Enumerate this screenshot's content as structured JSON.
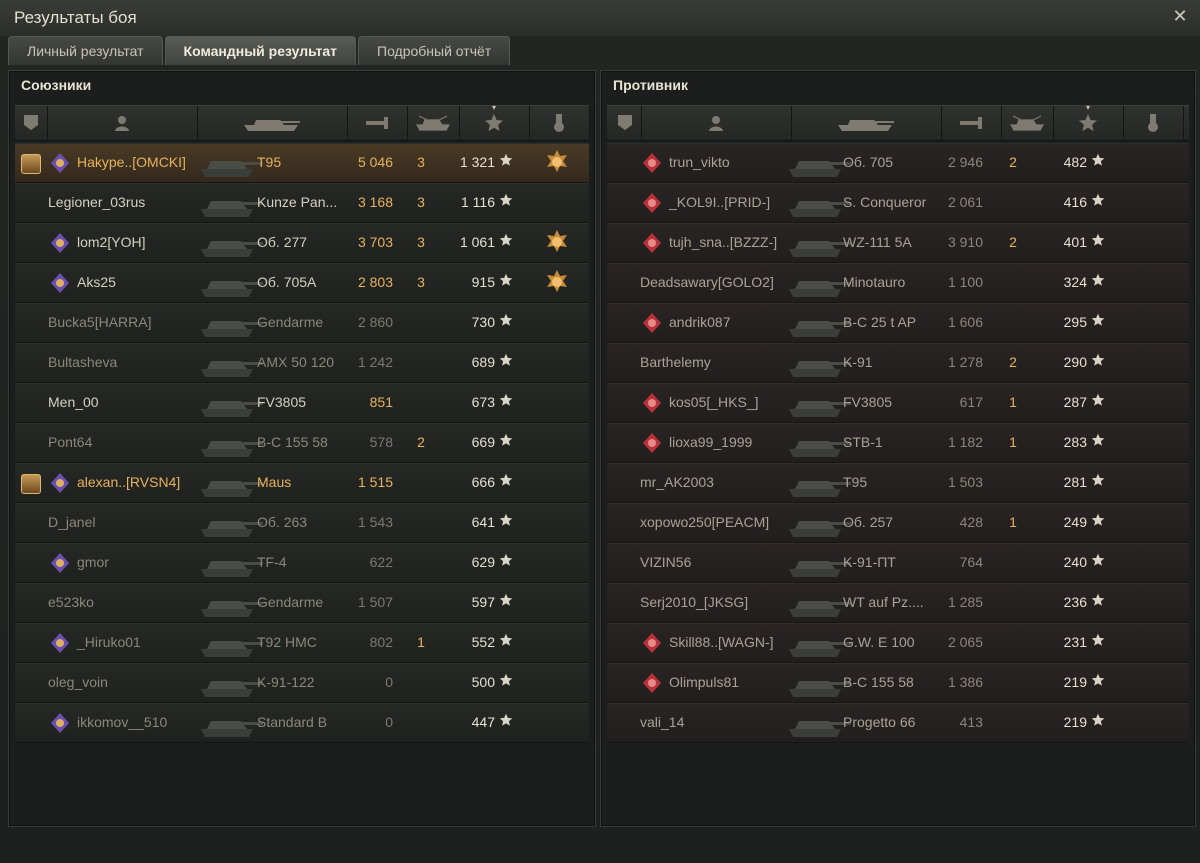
{
  "window": {
    "title": "Результаты боя"
  },
  "tabs": [
    {
      "label": "Личный результат",
      "active": false
    },
    {
      "label": "Командный результат",
      "active": true
    },
    {
      "label": "Подробный отчёт",
      "active": false
    }
  ],
  "allies": {
    "title": "Союзники",
    "rows": [
      {
        "name": "Hakype..[OMCKI]",
        "clan": true,
        "self": true,
        "vehicle": "T95",
        "damage": "5 046",
        "frags": "3",
        "xp": "1 321",
        "medal": true,
        "style": "gold"
      },
      {
        "name": "Legioner_03rus",
        "clan": false,
        "vehicle": "Kunze Pan...",
        "damage": "3 168",
        "frags": "3",
        "xp": "1 116",
        "medal": false,
        "style": "bright"
      },
      {
        "name": "lom2[YOH]",
        "clan": true,
        "vehicle": "Об. 277",
        "damage": "3 703",
        "frags": "3",
        "xp": "1 061",
        "medal": true,
        "style": "bright"
      },
      {
        "name": "Aks25",
        "clan": true,
        "vehicle": "Об. 705А",
        "damage": "2 803",
        "frags": "3",
        "xp": "915",
        "medal": true,
        "style": "bright"
      },
      {
        "name": "Bucka5[HARRA]",
        "clan": false,
        "vehicle": "Gendarme",
        "damage": "2 860",
        "frags": "",
        "xp": "730",
        "medal": false,
        "style": "dim"
      },
      {
        "name": "Bultasheva",
        "clan": false,
        "vehicle": "AMX 50 120",
        "damage": "1 242",
        "frags": "",
        "xp": "689",
        "medal": false,
        "style": "dim"
      },
      {
        "name": "Men_00",
        "clan": false,
        "vehicle": "FV3805",
        "damage": "851",
        "frags": "",
        "xp": "673",
        "medal": false,
        "style": "bright"
      },
      {
        "name": "Pont64",
        "clan": false,
        "vehicle": "B-C 155 58",
        "damage": "578",
        "frags": "2",
        "xp": "669",
        "medal": false,
        "style": "dim"
      },
      {
        "name": "alexan..[RVSN4]",
        "clan": true,
        "platoon": true,
        "vehicle": "Maus",
        "damage": "1 515",
        "frags": "",
        "xp": "666",
        "medal": false,
        "style": "gold"
      },
      {
        "name": "D_janel",
        "clan": false,
        "vehicle": "Об. 263",
        "damage": "1 543",
        "frags": "",
        "xp": "641",
        "medal": false,
        "style": "dim"
      },
      {
        "name": "gmor",
        "clan": true,
        "vehicle": "TF-4",
        "damage": "622",
        "frags": "",
        "xp": "629",
        "medal": false,
        "style": "dim"
      },
      {
        "name": "e523ko",
        "clan": false,
        "vehicle": "Gendarme",
        "damage": "1 507",
        "frags": "",
        "xp": "597",
        "medal": false,
        "style": "dim"
      },
      {
        "name": "_Hiruko01",
        "clan": true,
        "vehicle": "T92 HMC",
        "damage": "802",
        "frags": "1",
        "xp": "552",
        "medal": false,
        "style": "dim"
      },
      {
        "name": "oleg_voin",
        "clan": false,
        "vehicle": "K-91-122",
        "damage": "0",
        "frags": "",
        "xp": "500",
        "medal": false,
        "style": "dim"
      },
      {
        "name": "ikkomov__510",
        "clan": true,
        "vehicle": "Standard B",
        "damage": "0",
        "frags": "",
        "xp": "447",
        "medal": false,
        "style": "dim"
      }
    ]
  },
  "enemies": {
    "title": "Противник",
    "rows": [
      {
        "name": "trun_vikto",
        "clan": true,
        "vehicle": "Об. 705",
        "damage": "2 946",
        "frags": "2",
        "xp": "482"
      },
      {
        "name": "_KOL9I..[PRID-]",
        "clan": true,
        "vehicle": "S. Conqueror",
        "damage": "2 061",
        "frags": "",
        "xp": "416"
      },
      {
        "name": "tujh_sna..[BZZZ-]",
        "clan": true,
        "vehicle": "WZ-111 5A",
        "damage": "3 910",
        "frags": "2",
        "xp": "401"
      },
      {
        "name": "Deadsawary[GOLO2]",
        "clan": false,
        "vehicle": "Minotauro",
        "damage": "1 100",
        "frags": "",
        "xp": "324"
      },
      {
        "name": "andrik087",
        "clan": true,
        "vehicle": "B-C 25 t AP",
        "damage": "1 606",
        "frags": "",
        "xp": "295"
      },
      {
        "name": "Barthelemy",
        "clan": false,
        "vehicle": "K-91",
        "damage": "1 278",
        "frags": "2",
        "xp": "290"
      },
      {
        "name": "kos05[_HKS_]",
        "clan": true,
        "vehicle": "FV3805",
        "damage": "617",
        "frags": "1",
        "xp": "287"
      },
      {
        "name": "lioxa99_1999",
        "clan": true,
        "vehicle": "STB-1",
        "damage": "1 182",
        "frags": "1",
        "xp": "283"
      },
      {
        "name": "mr_AK2003",
        "clan": false,
        "vehicle": "T95",
        "damage": "1 503",
        "frags": "",
        "xp": "281"
      },
      {
        "name": "xopowo250[PEACM]",
        "clan": false,
        "vehicle": "Об. 257",
        "damage": "428",
        "frags": "1",
        "xp": "249"
      },
      {
        "name": "VIZIN56",
        "clan": false,
        "vehicle": "K-91-ПТ",
        "damage": "764",
        "frags": "",
        "xp": "240"
      },
      {
        "name": "Serj2010_[JKSG]",
        "clan": false,
        "vehicle": "WT auf Pz....",
        "damage": "1 285",
        "frags": "",
        "xp": "236"
      },
      {
        "name": "Skill88..[WAGN-]",
        "clan": true,
        "vehicle": "G.W. E 100",
        "damage": "2 065",
        "frags": "",
        "xp": "231"
      },
      {
        "name": "Olimpuls81",
        "clan": true,
        "vehicle": "B-C 155 58",
        "damage": "1 386",
        "frags": "",
        "xp": "219"
      },
      {
        "name": "vali_14",
        "clan": false,
        "vehicle": "Progetto 66",
        "damage": "413",
        "frags": "",
        "xp": "219"
      }
    ]
  },
  "icons": {
    "col_platoon": "platoon-icon",
    "col_player": "player-icon",
    "col_vehicle": "tank-icon",
    "col_damage": "damage-icon",
    "col_frags": "frags-icon",
    "col_xp": "star-icon",
    "col_medal": "medal-icon",
    "close": "close-icon"
  },
  "colors": {
    "gold": "#e7b25c",
    "text": "#b9b4a6",
    "self_row": "#4a3a26",
    "enemy_row": "#2a2424"
  }
}
